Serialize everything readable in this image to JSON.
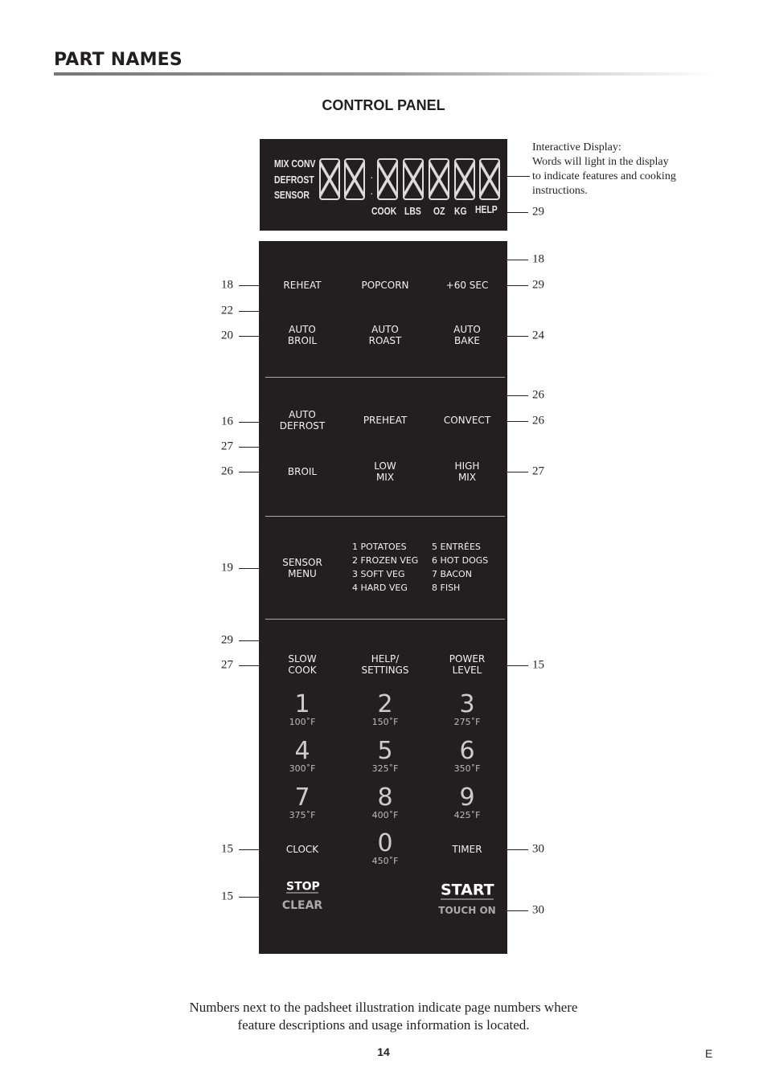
{
  "header": {
    "title": "PART NAMES",
    "subtitle": "CONTROL PANEL"
  },
  "display": {
    "indicators": [
      "MIX CONV",
      "DEFROST",
      "SENSOR"
    ],
    "bottom_words": [
      "COOK",
      "LBS",
      "OZ",
      "KG",
      "HELP"
    ],
    "note": [
      "Interactive Display:",
      "Words will light in the display",
      "to indicate features and cooking",
      "instructions."
    ]
  },
  "pads": {
    "reheat": "REHEAT",
    "popcorn": "POPCORN",
    "plus60": "+60 SEC",
    "auto_broil": [
      "AUTO",
      "BROIL"
    ],
    "auto_roast": [
      "AUTO",
      "ROAST"
    ],
    "auto_bake": [
      "AUTO",
      "BAKE"
    ],
    "auto_defrost": [
      "AUTO",
      "DEFROST"
    ],
    "preheat": "PREHEAT",
    "convect": "CONVECT",
    "broil": "BROIL",
    "low_mix": [
      "LOW",
      "MIX"
    ],
    "high_mix": [
      "HIGH",
      "MIX"
    ],
    "sensor_menu": [
      "SENSOR",
      "MENU"
    ],
    "sensor_items": [
      "1 POTATOES",
      "2 FROZEN VEG",
      "3 SOFT VEG",
      "4 HARD VEG",
      "5 ENTRÉES",
      "6 HOT DOGS",
      "7 BACON",
      "8 FISH"
    ],
    "slow_cook": [
      "SLOW",
      "COOK"
    ],
    "help_settings": [
      "HELP/",
      "SETTINGS"
    ],
    "power_level": [
      "POWER",
      "LEVEL"
    ],
    "keys": [
      {
        "d": "1",
        "t": "100˚F"
      },
      {
        "d": "2",
        "t": "150˚F"
      },
      {
        "d": "3",
        "t": "275˚F"
      },
      {
        "d": "4",
        "t": "300˚F"
      },
      {
        "d": "5",
        "t": "325˚F"
      },
      {
        "d": "6",
        "t": "350˚F"
      },
      {
        "d": "7",
        "t": "375˚F"
      },
      {
        "d": "8",
        "t": "400˚F"
      },
      {
        "d": "9",
        "t": "425˚F"
      },
      {
        "d": "0",
        "t": "450˚F"
      }
    ],
    "clock": "CLOCK",
    "timer": "TIMER",
    "stop": "STOP",
    "clear": "CLEAR",
    "start": "START",
    "touch_on": "TOUCH ON"
  },
  "callouts_left": [
    "18",
    "22",
    "20",
    "16",
    "27",
    "26",
    "19",
    "29",
    "27",
    "15",
    "15"
  ],
  "callouts_right": [
    "29",
    "18",
    "29",
    "24",
    "26",
    "26",
    "27",
    "15",
    "30",
    "30"
  ],
  "footer": {
    "note": [
      "Numbers next to the padsheet illustration indicate page numbers where",
      "feature descriptions and usage information is located."
    ],
    "page": "14",
    "lang": "E"
  }
}
